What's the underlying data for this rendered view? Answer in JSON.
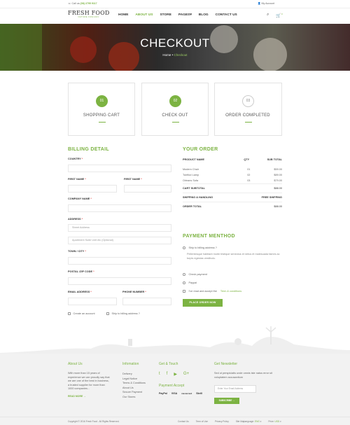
{
  "topbar": {
    "call_prefix": "Call us",
    "phone": "(08) 2795 9117",
    "account": "My Account"
  },
  "header": {
    "logo_title": "FRESH FOOD",
    "logo_tagline": "NATURE ORGANIC",
    "nav": [
      "HOME",
      "ABOUT US",
      "STORE",
      "PAGES",
      "BLOG",
      "CONTACT US"
    ],
    "active_nav": "ABOUT US",
    "search_icon": "search-icon",
    "cart_icon": "cart-icon",
    "cart_count": "0",
    "pages_arrow": "▾",
    "cart_glyph": "🛒",
    "search_glyph": "⌕"
  },
  "hero": {
    "title": "CHECKOUT",
    "breadcrumb_home": "Home",
    "breadcrumb_sep": "•",
    "breadcrumb_current": "Checkout"
  },
  "steps": [
    {
      "num": "01",
      "label": "SHOPPING CART",
      "active": true
    },
    {
      "num": "02",
      "label": "CHECK OUT",
      "active": true
    },
    {
      "num": "03",
      "label": "ORDER COMPLETED",
      "active": false
    }
  ],
  "billing": {
    "title": "BILLING DETAIL",
    "country": "COUNTRY",
    "first_name": "FIRST NAME",
    "first_name2": "FIRST NAME",
    "company": "COMPANY NAME",
    "address": "ADDRESS",
    "street_placeholder": "Street Address",
    "apt_placeholder": "Apartment Suite Unit etc (Optional)",
    "town": "TOWN / CITY",
    "postal": "POSTAL /ZIP CODE",
    "email": "EMAIL ADDRESS",
    "phone": "PHONE NUMBER",
    "create_account": "Create an account",
    "ship_billing": "Ship to billing address ?",
    "required_mark": "*"
  },
  "order": {
    "title": "YOUR ORDER",
    "col_product": "PRODUCT NAME",
    "col_qty": "QTY",
    "col_subtotal": "SUB TOTAL",
    "items": [
      {
        "name": "Modern Chair",
        "qty": "01",
        "price": "$59.00"
      },
      {
        "name": "Tubflod Lamp",
        "qty": "02",
        "price": "$89.00"
      },
      {
        "name": "Orleans Sofa",
        "qty": "03",
        "price": "$79.00"
      }
    ],
    "cart_subtotal_label": "CART SUBTOTAL",
    "cart_subtotal": "$88.00",
    "shipping_label": "SHIPPING & HANDLING",
    "shipping": "FREE SHIPPING",
    "order_total_label": "ORDER TOTAL",
    "order_total": "$88.00"
  },
  "payment": {
    "title": "PAYMENT MENTHOD",
    "ship_billing": "Ship to billing address ?",
    "note": "Pellentesque habitant morbi tristique senectus et netus et malesuada fames ac turpis egestas vestibulu.",
    "option1": "Check payment",
    "option2": "Paypal",
    "agree_prefix": "I've read and accept the",
    "agree_link": "Term & conditions",
    "place_order": "PLACE ORDER NOW"
  },
  "footer": {
    "about_title": "About Us",
    "about_text": "With more than 15 years of experience we can proudly say that we are one of the best in business, a trusted supplier for more than 1000 companies...",
    "read_more": "READ MORE",
    "info_title": "Infomation",
    "info_links": [
      "Delivery",
      "Legal Notice",
      "Terms & Conditions",
      "About Us",
      "Secure Payment",
      "Our Stores"
    ],
    "touch_title": "Get & Touch",
    "social": [
      "twitter-icon",
      "facebook-icon",
      "youtube-icon",
      "google-plus-icon"
    ],
    "social_glyphs": [
      "t",
      "f",
      "▶",
      "G+"
    ],
    "payment_title": "Payment Accept",
    "payment_methods": [
      "PayPal",
      "VISA",
      "mastercard",
      "Skrill"
    ],
    "newsletter_title": "Get Newsletter",
    "newsletter_text": "Sed ut perspiciatis unde omnis iste natus error sit voluptatem accusantium",
    "email_placeholder": "Enter Your Email Address",
    "subscribe": "SUBSCRIBE"
  },
  "bottombar": {
    "copyright": "Copyright © 2016 Fresh Food . All Rights Reserved.",
    "links": [
      "Contact Us",
      "Term of Use",
      "Privacy Policy",
      "Site Map"
    ],
    "language_label": "Language:",
    "language": "ENG",
    "price_label": "Price:",
    "price": "USD"
  },
  "colors": {
    "accent": "#7cb342",
    "text": "#555555",
    "footer_bg": "#f2f2f2"
  }
}
